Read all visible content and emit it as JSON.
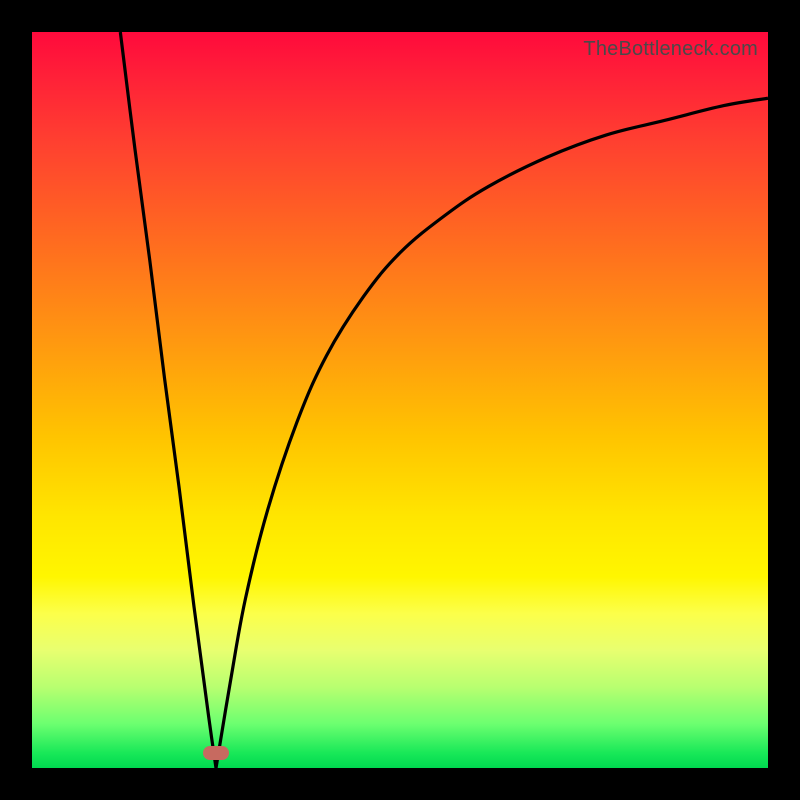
{
  "watermark": "TheBottleneck.com",
  "colors": {
    "frame": "#000000",
    "curve": "#000000",
    "marker": "#c76a60",
    "gradient_stops": [
      "#ff0a3c",
      "#ff4030",
      "#ff9810",
      "#ffe600",
      "#fcff4a",
      "#6cff70",
      "#00d850"
    ]
  },
  "chart_data": {
    "type": "line",
    "title": "",
    "xlabel": "",
    "ylabel": "",
    "xlim": [
      0,
      100
    ],
    "ylim": [
      0,
      100
    ],
    "grid": false,
    "legend": false,
    "annotations": [
      {
        "kind": "marker",
        "x": 25,
        "y": 2,
        "shape": "pill",
        "color": "#c76a60"
      }
    ],
    "series": [
      {
        "name": "left-segment",
        "x": [
          12,
          14,
          16,
          18,
          20,
          22,
          24,
          25
        ],
        "values": [
          100,
          84,
          69,
          53,
          38,
          22,
          7,
          0
        ]
      },
      {
        "name": "right-segment",
        "x": [
          25,
          27,
          29,
          32,
          36,
          40,
          45,
          50,
          56,
          62,
          70,
          78,
          86,
          94,
          100
        ],
        "values": [
          0,
          12,
          23,
          35,
          47,
          56,
          64,
          70,
          75,
          79,
          83,
          86,
          88,
          90,
          91
        ]
      }
    ],
    "background": {
      "type": "vertical-gradient",
      "description": "red at top through orange/yellow to green at bottom"
    }
  }
}
